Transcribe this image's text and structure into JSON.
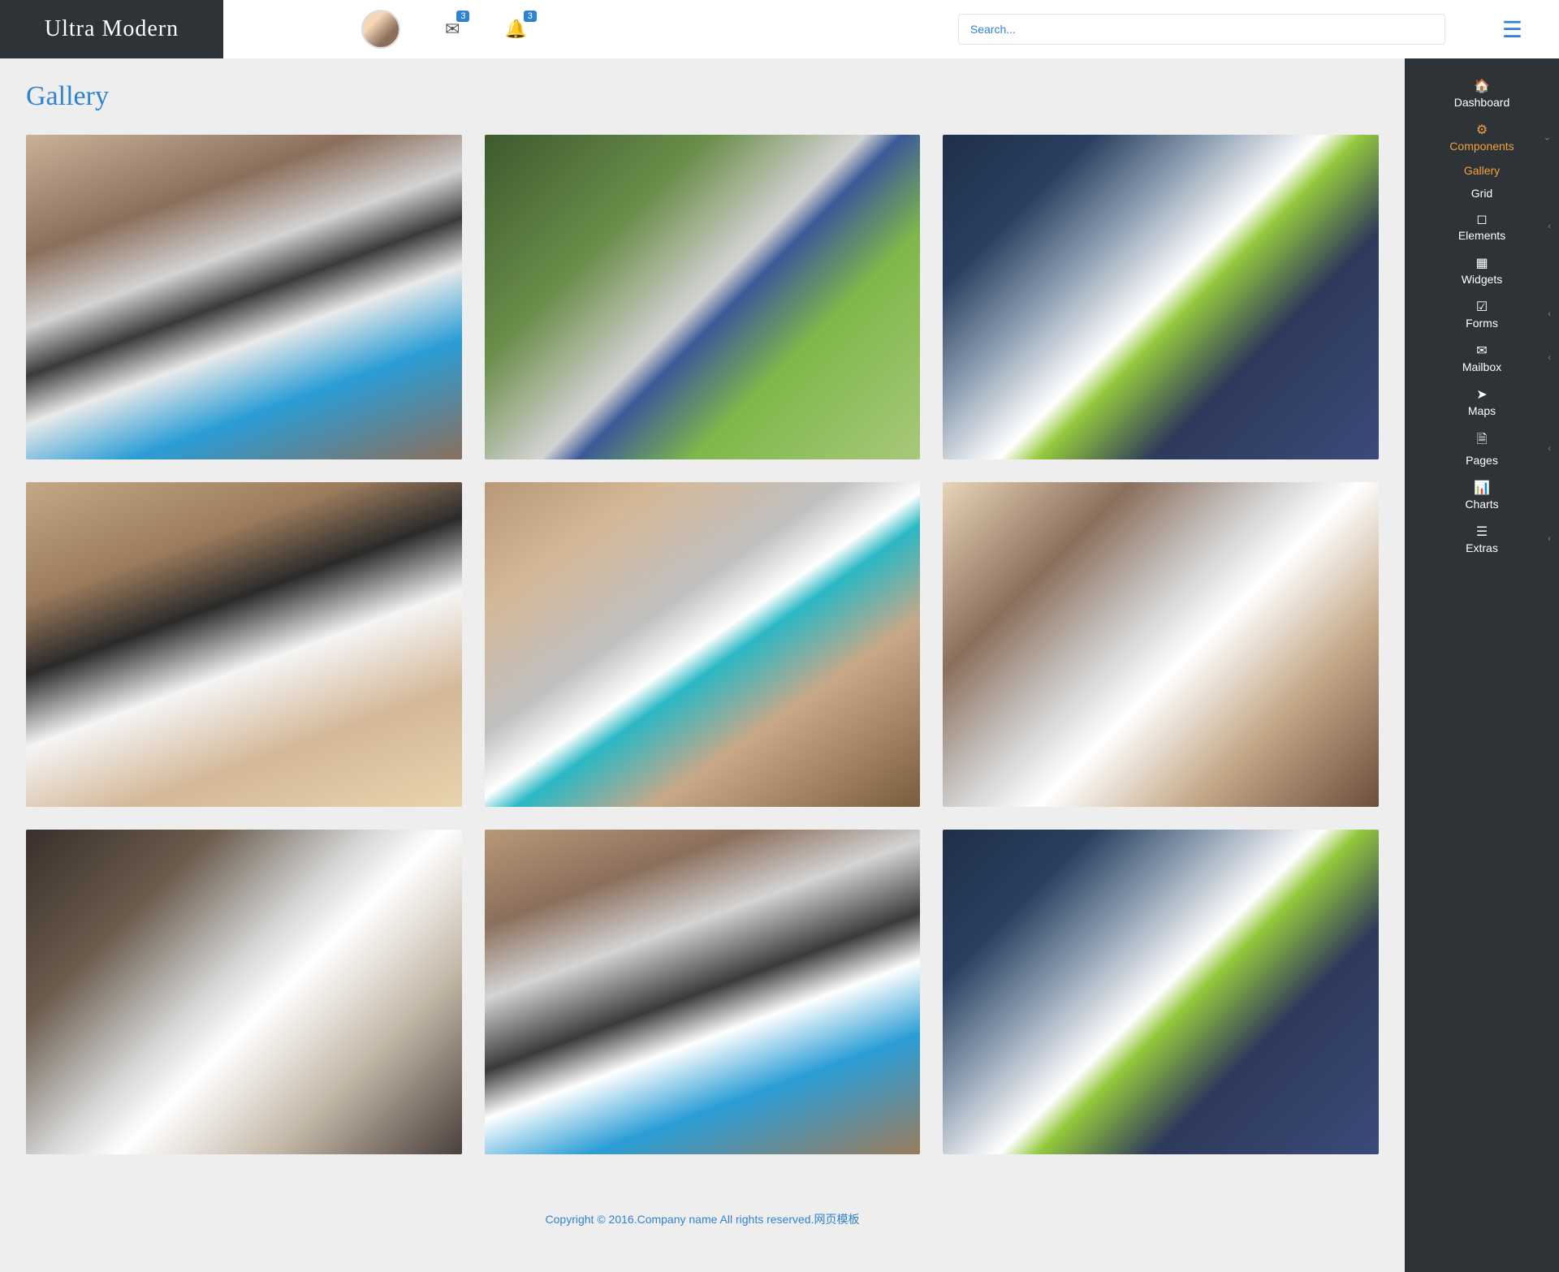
{
  "header": {
    "logo": "Ultra Modern",
    "badge_mail": "3",
    "badge_bell": "3",
    "search_placeholder": "Search..."
  },
  "page": {
    "title": "Gallery"
  },
  "sidebar": {
    "items": [
      {
        "label": "Dashboard"
      },
      {
        "label": "Components"
      },
      {
        "label": "Gallery"
      },
      {
        "label": "Grid"
      },
      {
        "label": "Elements"
      },
      {
        "label": "Widgets"
      },
      {
        "label": "Forms"
      },
      {
        "label": "Mailbox"
      },
      {
        "label": "Maps"
      },
      {
        "label": "Pages"
      },
      {
        "label": "Charts"
      },
      {
        "label": "Extras"
      }
    ]
  },
  "footer": {
    "text": "Copyright © 2016.Company name All rights reserved.网页模板"
  }
}
